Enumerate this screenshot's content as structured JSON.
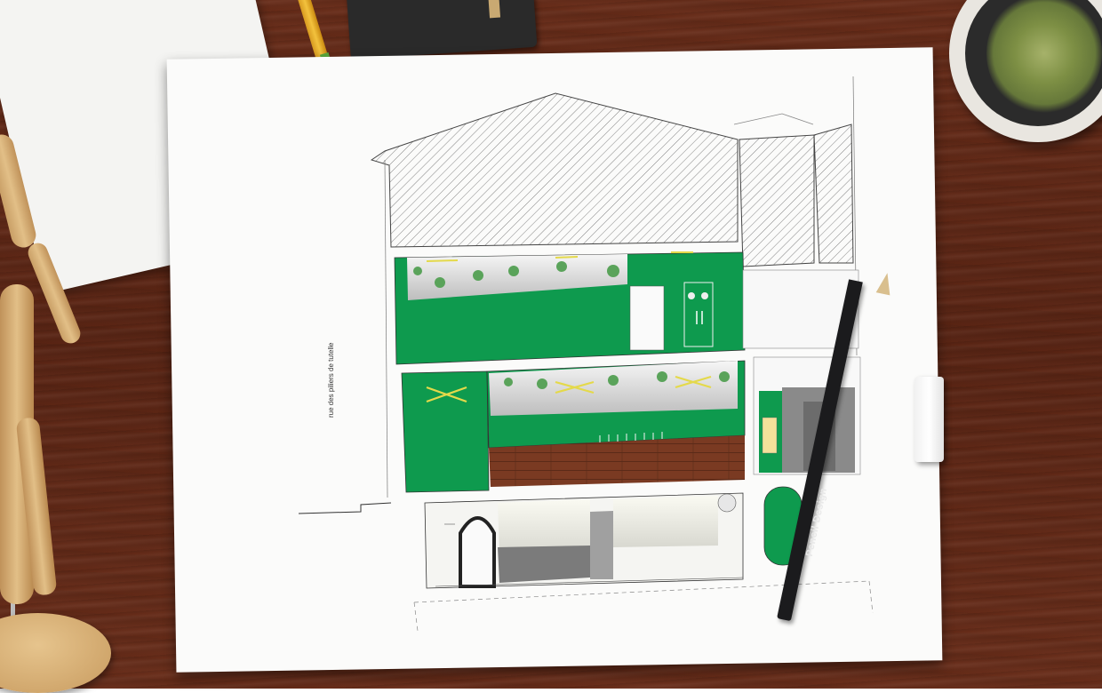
{
  "scene": {
    "street_label": "rue des piliers de tutelle",
    "pencil_brand": "Pencil Design"
  },
  "colors": {
    "desk": "#5e2817",
    "paper": "#fbfbfa",
    "lawn": "#0e9a4e",
    "deck": "#7a3a22",
    "hatch": "#555555",
    "accent_yellow": "#e4d94a"
  },
  "icons": [
    "mannequin",
    "notebook",
    "pencil",
    "pen",
    "eraser",
    "cactus-pot"
  ]
}
